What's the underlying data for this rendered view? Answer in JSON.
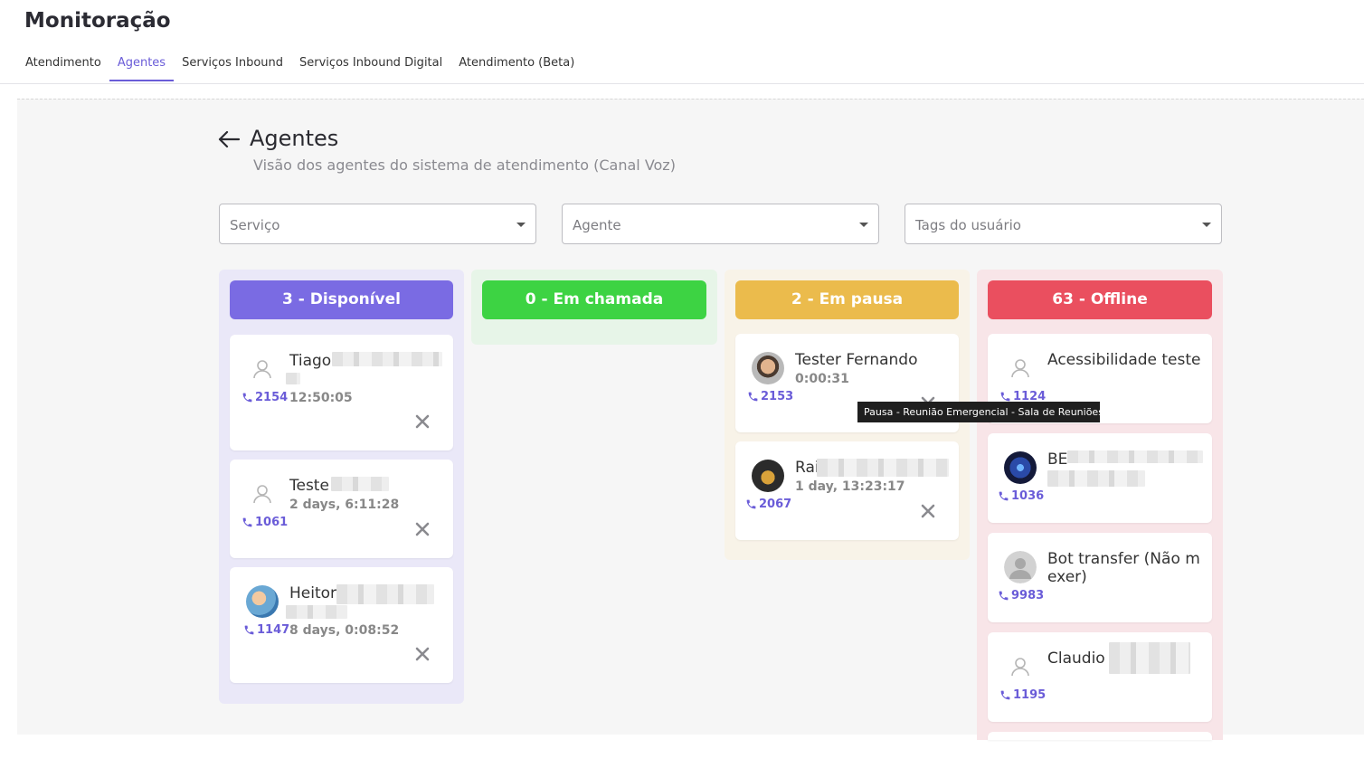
{
  "app": {
    "title": "Monitoração"
  },
  "tabs": [
    {
      "label": "Atendimento"
    },
    {
      "label": "Agentes"
    },
    {
      "label": "Serviços Inbound"
    },
    {
      "label": "Serviços Inbound Digital"
    },
    {
      "label": "Atendimento (Beta)"
    }
  ],
  "active_tab": "Agentes",
  "page": {
    "title": "Agentes",
    "subtitle": "Visão dos agentes do sistema de atendimento (Canal Voz)"
  },
  "filters": {
    "service": "Serviço",
    "agent": "Agente",
    "tags": "Tags do usuário"
  },
  "columns": {
    "available": {
      "label": "3 - Disponível",
      "color": "#7a6be3",
      "bg": "#eae8f8",
      "agents": [
        {
          "name": "Tiago",
          "time": "12:50:05",
          "ext": "2154",
          "avatar": "placeholder-user-icon"
        },
        {
          "name": "Teste",
          "time": "2 days, 6:11:28",
          "ext": "1061",
          "avatar": "placeholder-user-icon"
        },
        {
          "name": "Heitor",
          "time": "8 days, 0:08:52",
          "ext": "1147",
          "avatar": "photo"
        }
      ]
    },
    "in_call": {
      "label": "0 - Em chamada",
      "color": "#3dd343",
      "bg": "#e7f5e8"
    },
    "paused": {
      "label": "2 - Em pausa",
      "color": "#ebbb4c",
      "bg": "#f8f3e8",
      "agents": [
        {
          "name": "Tester Fernando",
          "time": "0:00:31",
          "ext": "2153",
          "avatar": "photo"
        },
        {
          "name": "Rai",
          "time": "1 day, 13:23:17",
          "ext": "2067",
          "avatar": "photo"
        }
      ]
    },
    "offline": {
      "label": "63 - Offline",
      "color": "#ea4f5f",
      "bg": "#f8e5e8",
      "agents": [
        {
          "name": "Acessibilidade teste",
          "ext": "1124",
          "avatar": "placeholder-user-icon"
        },
        {
          "name": "BE",
          "ext": "1036",
          "avatar": "photo"
        },
        {
          "name": "Bot transfer (Não m exer)",
          "name_line1": "Bot transfer (Não m",
          "name_line2": "exer)",
          "ext": "9983",
          "avatar": "default-avatar-icon"
        },
        {
          "name": "Claudio",
          "ext": "1195",
          "avatar": "placeholder-user-icon"
        }
      ]
    }
  },
  "tooltip": "Pausa - Reunião Emergencial - Sala de Reuniões"
}
